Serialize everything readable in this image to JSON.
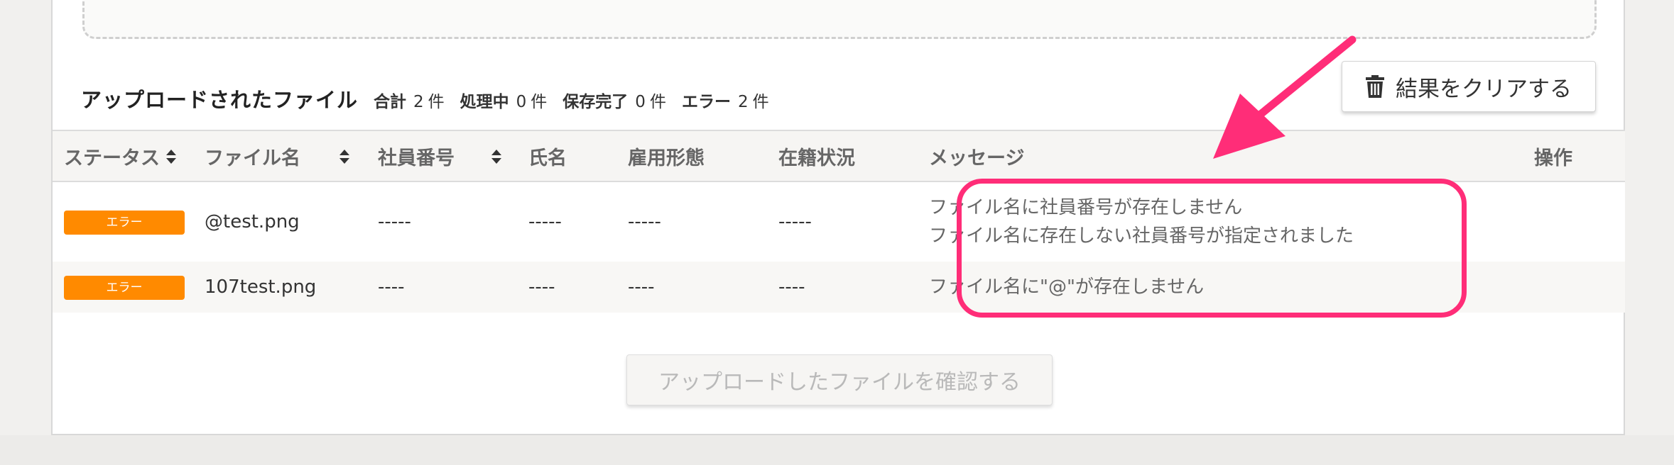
{
  "section": {
    "title": "アップロードされたファイル",
    "stats": [
      {
        "label": "合計",
        "count": "2",
        "unit": "件"
      },
      {
        "label": "処理中",
        "count": "0",
        "unit": "件"
      },
      {
        "label": "保存完了",
        "count": "0",
        "unit": "件"
      },
      {
        "label": "エラー",
        "count": "2",
        "unit": "件"
      }
    ]
  },
  "clear_button": {
    "label": "結果をクリアする",
    "icon": "trash-icon"
  },
  "table": {
    "columns": [
      "ステータス",
      "ファイル名",
      "社員番号",
      "氏名",
      "雇用形態",
      "在籍状況",
      "メッセージ",
      "操作"
    ],
    "rows": [
      {
        "status": "エラー",
        "file_name": "@test.png",
        "employee_number": "-----",
        "name": "-----",
        "employment_type": "-----",
        "enrollment_status": "-----",
        "messages": [
          "ファイル名に社員番号が存在しません",
          "ファイル名に存在しない社員番号が指定されました"
        ],
        "actions": ""
      },
      {
        "status": "エラー",
        "file_name": "107test.png",
        "employee_number": "----",
        "name": "----",
        "employment_type": "----",
        "enrollment_status": "----",
        "messages": [
          "ファイル名に\"@\"が存在しません"
        ],
        "actions": ""
      }
    ]
  },
  "confirm_button": {
    "label": "アップロードしたファイルを確認する"
  },
  "colors": {
    "error_badge": "#ff8a00",
    "highlight": "#ff2d78"
  }
}
